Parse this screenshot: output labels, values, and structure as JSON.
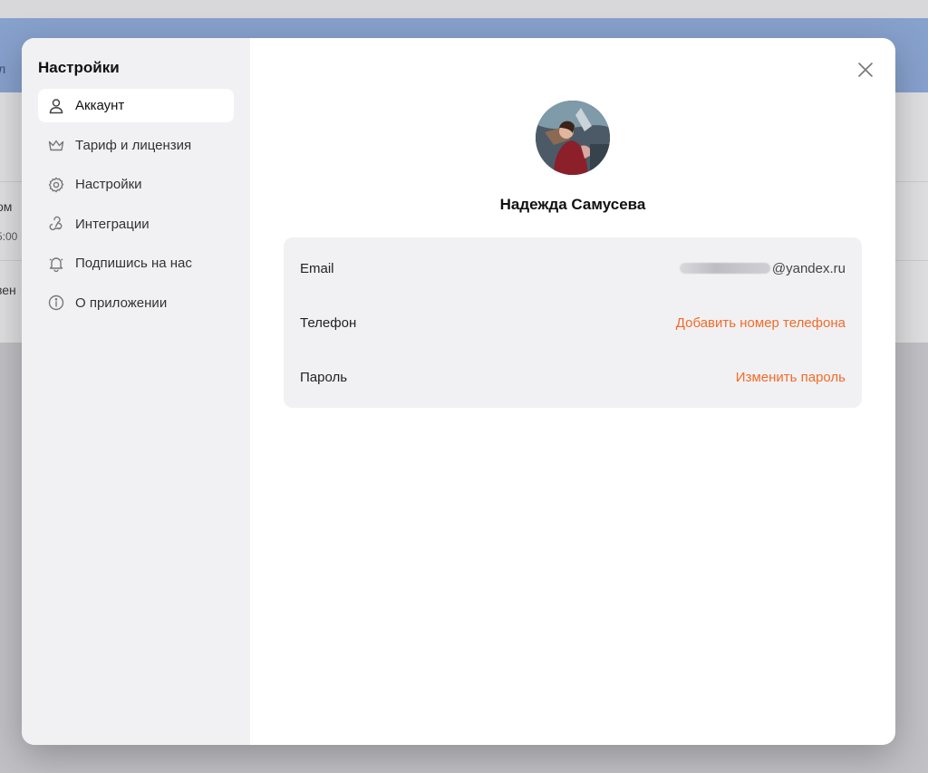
{
  "background": {
    "fragments": [
      "л",
      "ом",
      "5:00",
      "зен"
    ]
  },
  "settings": {
    "title": "Настройки",
    "nav": [
      {
        "label": "Аккаунт",
        "icon": "user-icon",
        "active": true
      },
      {
        "label": "Тариф и лицензия",
        "icon": "crown-icon",
        "active": false
      },
      {
        "label": "Настройки",
        "icon": "gear-icon",
        "active": false
      },
      {
        "label": "Интеграции",
        "icon": "webhook-icon",
        "active": false
      },
      {
        "label": "Подпишись на нас",
        "icon": "bell-icon",
        "active": false
      },
      {
        "label": "О приложении",
        "icon": "info-icon",
        "active": false
      }
    ]
  },
  "profile": {
    "name": "Надежда Самусева",
    "avatar": "avatar-photo"
  },
  "account": {
    "email_label": "Email",
    "email_value": "@yandex.ru",
    "phone_label": "Телефон",
    "phone_action": "Добавить номер телефона",
    "password_label": "Пароль",
    "password_action": "Изменить пароль"
  },
  "colors": {
    "accent": "#f26b2a",
    "sidebar_bg": "#f1f1f3",
    "header_bg": "#8fb0e6"
  }
}
